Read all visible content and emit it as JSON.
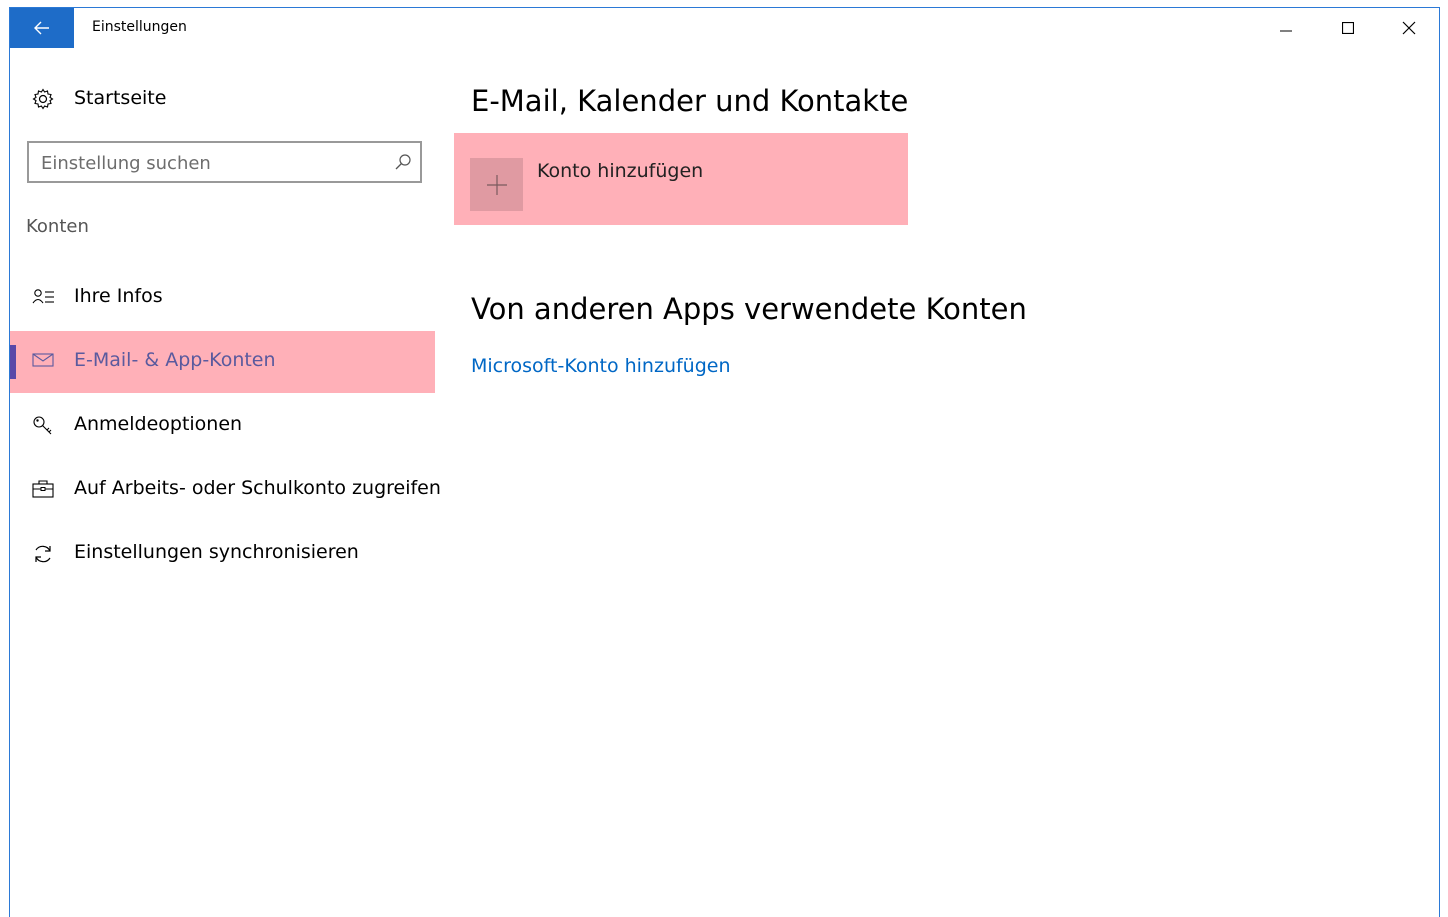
{
  "window": {
    "title": "Einstellungen"
  },
  "colors": {
    "accent": "#1e6cc8",
    "highlight": "#ffb0b8",
    "link": "#0067c5",
    "selection_bar": "#5a48a8"
  },
  "sidebar": {
    "home_label": "Startseite",
    "search_placeholder": "Einstellung suchen",
    "section_label": "Konten",
    "items": [
      {
        "label": "Ihre Infos",
        "icon": "contact-info-icon",
        "selected": false
      },
      {
        "label": "E-Mail- & App-Konten",
        "icon": "mail-icon",
        "selected": true
      },
      {
        "label": "Anmeldeoptionen",
        "icon": "key-icon",
        "selected": false
      },
      {
        "label": "Auf Arbeits- oder Schulkonto zugreifen",
        "icon": "briefcase-icon",
        "selected": false
      },
      {
        "label": "Einstellungen synchronisieren",
        "icon": "sync-icon",
        "selected": false
      }
    ]
  },
  "main": {
    "section1_title": "E-Mail, Kalender und Kontakte",
    "add_account_label": "Konto hinzufügen",
    "section2_title": "Von anderen Apps verwendete Konten",
    "ms_account_link": "Microsoft-Konto hinzufügen"
  }
}
